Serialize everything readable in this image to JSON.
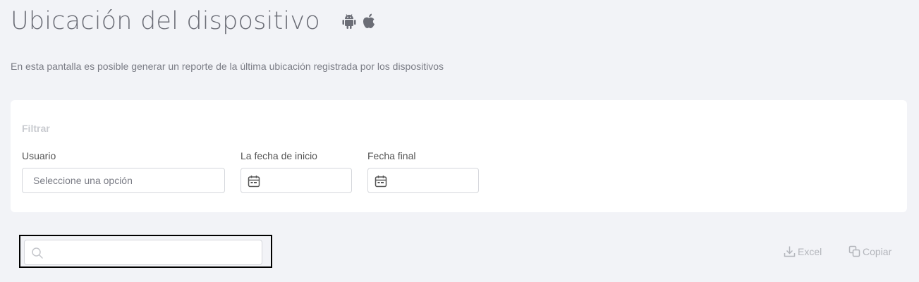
{
  "header": {
    "title": "Ubicación del dispositivo",
    "platform_icons": [
      "android-icon",
      "apple-icon"
    ],
    "subtitle": "En esta pantalla es posible generar un reporte de la última ubicación registrada por los dispositivos"
  },
  "filter": {
    "heading": "Filtrar",
    "user": {
      "label": "Usuario",
      "placeholder": "Seleccione una opción"
    },
    "start_date": {
      "label": "La fecha de inicio",
      "value": "",
      "icon": "calendar-icon"
    },
    "end_date": {
      "label": "Fecha final",
      "value": "",
      "icon": "calendar-icon"
    }
  },
  "toolbar": {
    "search": {
      "value": "",
      "icon": "search-icon"
    },
    "excel_label": "Excel",
    "copy_label": "Copiar"
  },
  "colors": {
    "background": "#f2f3f7",
    "card": "#ffffff",
    "muted_text": "#b3b5bb",
    "title": "#6b6d76"
  }
}
